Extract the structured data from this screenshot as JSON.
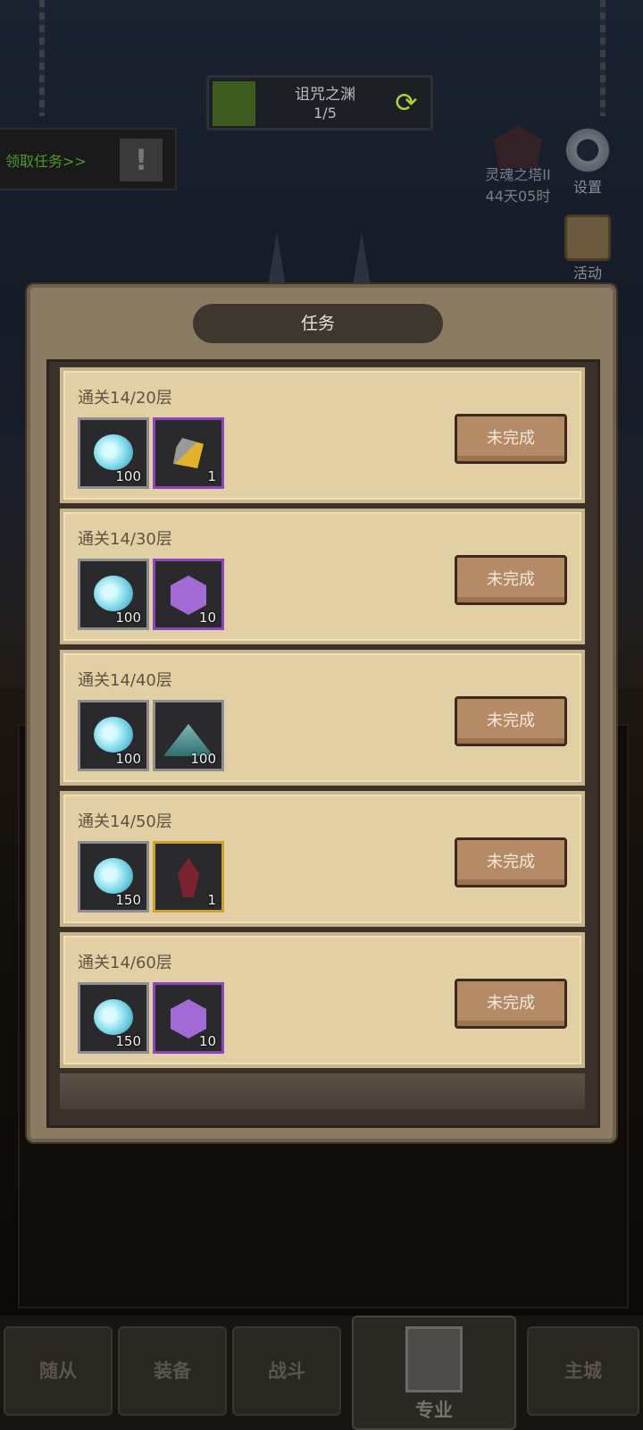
{
  "top": {
    "level_name": "诅咒之渊",
    "level_progress": "1/5"
  },
  "quest_tab": {
    "label": "领取任务>>"
  },
  "right_panel": {
    "tower_name": "灵魂之塔II",
    "tower_time": "44天05时",
    "settings_label": "设置",
    "events_label": "活动"
  },
  "dialog": {
    "title": "任务",
    "tasks": [
      {
        "title": "通关14/20层",
        "rewards": [
          {
            "icon": "soul-icon",
            "qty": "100",
            "frame": "gray"
          },
          {
            "icon": "ore-icon",
            "qty": "1",
            "frame": "purple"
          }
        ],
        "status": "未完成"
      },
      {
        "title": "通关14/30层",
        "rewards": [
          {
            "icon": "soul-icon",
            "qty": "100",
            "frame": "gray"
          },
          {
            "icon": "hex-gem-icon",
            "qty": "10",
            "frame": "purple"
          }
        ],
        "status": "未完成"
      },
      {
        "title": "通关14/40层",
        "rewards": [
          {
            "icon": "soul-icon",
            "qty": "100",
            "frame": "gray"
          },
          {
            "icon": "pyramid-icon",
            "qty": "100",
            "frame": "gray"
          }
        ],
        "status": "未完成"
      },
      {
        "title": "通关14/50层",
        "rewards": [
          {
            "icon": "soul-icon",
            "qty": "150",
            "frame": "gray"
          },
          {
            "icon": "crystal-icon",
            "qty": "1",
            "frame": "gold"
          }
        ],
        "status": "未完成"
      },
      {
        "title": "通关14/60层",
        "rewards": [
          {
            "icon": "soul-icon",
            "qty": "150",
            "frame": "gray"
          },
          {
            "icon": "hex-gem-icon",
            "qty": "10",
            "frame": "purple"
          }
        ],
        "status": "未完成"
      }
    ]
  },
  "nav": {
    "items": [
      "随从",
      "装备",
      "战斗",
      "专业",
      "主城"
    ]
  }
}
